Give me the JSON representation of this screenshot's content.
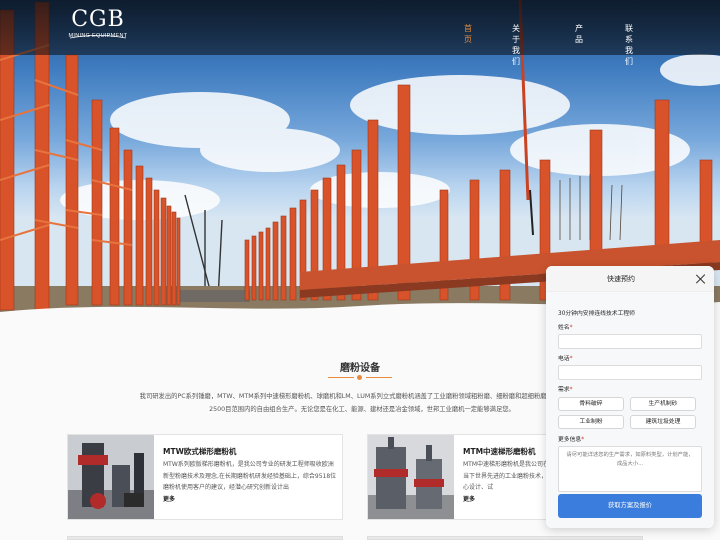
{
  "header": {
    "logo": {
      "mark": "CGB",
      "sub": "MINING EQUIPMENT"
    },
    "nav": [
      {
        "label": "首页",
        "active": true
      },
      {
        "label": "关于我们",
        "active": false
      },
      {
        "label": "产品",
        "active": false
      },
      {
        "label": "联系我们",
        "active": false
      }
    ]
  },
  "section": {
    "title": "磨粉设备",
    "description": "我司研发出的PC系列锤磨，MTW、MTM系列中速梯形磨粉机、球磨机和LM、LUM系列立式磨粉机涵盖了工业磨粉领域粗粉磨、细粉磨和超细粉磨需求，实现0-2500目范围内的自由组合生产。无论您是在化工、能源、建材还是冶金领域，世邦工业磨机一定能够满足您。"
  },
  "products": [
    {
      "title": "MTW欧式梯形磨粉机",
      "text": "MTW系列欧版梯形磨粉机，是我公司专业的研发工程师吸收欧洲新型粉磨技术及理念,在长期磨粉机研发经验基础上，综合9518位磨粉机使用客户的建议，经潜心研究创新设计出",
      "more": "更多"
    },
    {
      "title": "MTM中速梯形磨粉机",
      "text": "MTM中速梯形磨粉机是我公司在多年研发磨粉机的基础上，引进当下世界先进的工业磨粉技术，结合用户需求相关工程人员经过精心设计、试",
      "more": "更多"
    }
  ],
  "booking": {
    "title": "快速预约",
    "subtitle": "30分钟内安排连线技术工程师",
    "fields": {
      "name_label": "姓名",
      "phone_label": "电话",
      "needs_label": "需求",
      "info_label": "更多信息",
      "required_mark": "*",
      "info_placeholder": "请尽可能详述您的生产需求，如原料类型，计划产能，成品大小..."
    },
    "options": [
      "骨料破碎",
      "生产机制砂",
      "工业制粉",
      "建筑垃圾处理"
    ],
    "submit_label": "获取方案及报价"
  },
  "colors": {
    "accent": "#e88a3a",
    "button": "#3b7ddc",
    "steel": "#d8522a"
  }
}
